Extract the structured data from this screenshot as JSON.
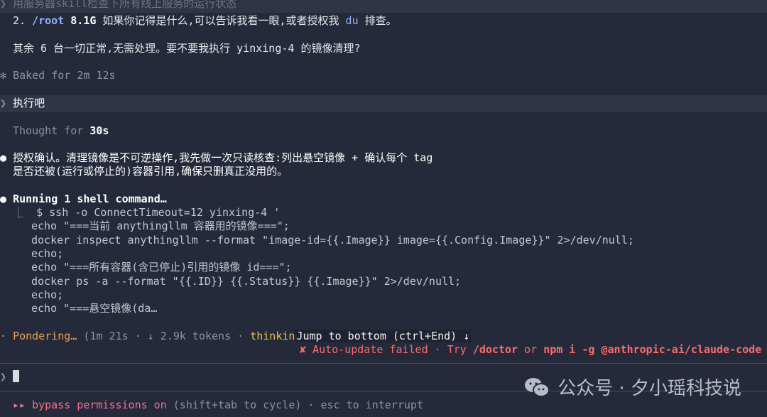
{
  "header_prompt": "用服务器skill检查下所有线上服务的运行状态",
  "message_top": {
    "num": "2.",
    "path": "/root",
    "size": "8.1G",
    "text1": " 如果你记得是什么,可以告诉我看一眼,或者授权我 ",
    "du": "du",
    "text2": " 排查。"
  },
  "others_line": "其余 6 台一切正常,无需处理。要不要我执行 yinxing-4 的镜像清理?",
  "baked": {
    "glyph": "✻",
    "text": "Baked for 2m 12s"
  },
  "user_prompt": {
    "chevron": "❯",
    "text": "执行吧"
  },
  "thought": {
    "prefix": "Thought for ",
    "time": "30s"
  },
  "assistant": {
    "bullet": "●",
    "line1": "授权确认。清理镜像是不可逆操作,我先做一次只读核查:列出悬空镜像 + 确认每个 tag",
    "line2": "是否还被(运行或停止的)容器引用,确保只删真正没用的。"
  },
  "running": {
    "bullet": "●",
    "prefix": "Running ",
    "count": "1",
    "suffix": " shell command…"
  },
  "command_lines": [
    "$ ssh -o ConnectTimeout=12 yinxing-4 '",
    "echo \"===当前 anythingllm 容器用的镜像===\";",
    "docker inspect anythingllm --format \"image-id={{.Image}} image={{.Config.Image}}\" 2>/dev/null;",
    "echo;",
    "echo \"===所有容器(含已停止)引用的镜像 id===\";",
    "docker ps -a --format \"{{.ID}} {{.Status}} {{.Image}}\" 2>/dev/null;",
    "echo;",
    "echo \"===悬空镜像(da…"
  ],
  "status": {
    "glyph": "·",
    "word": "Pondering…",
    "meta": " (1m 21s · ↓ 2.9k tokens · ",
    "thinking": "thinkin",
    "jump": "Jump to bottom (ctrl+End) ↓"
  },
  "update": {
    "x": "✘",
    "text": " Auto-update failed · Try ",
    "doctor": "/doctor",
    "or": " or ",
    "npm": "npm i -g @anthropic-ai/claude-code"
  },
  "input": {
    "chevron": "❯"
  },
  "footer": {
    "arrows": "▸▸",
    "label": " bypass permissions on",
    "hint": " (shift+tab to cycle) · esc to interrupt"
  },
  "watermark": "公众号 · 夕小瑶科技说",
  "colors": {
    "accent_orange": "#e6a14d",
    "error_red": "#ff6b6b",
    "bypass_pink": "#f5708e",
    "command_blue": "#8fb4ff"
  }
}
